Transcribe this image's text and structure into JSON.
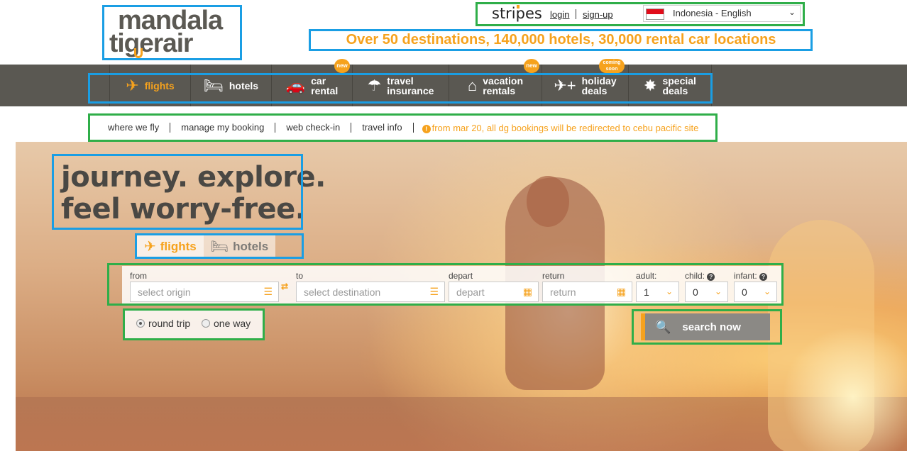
{
  "logo": {
    "line1": "mandala",
    "line2": "tigerair"
  },
  "topbar": {
    "brand": "stripes",
    "login": "login",
    "signup": "sign-up",
    "language": "Indonesia - English"
  },
  "tagline": "Over 50 destinations, 140,000 hotels, 30,000 rental car locations",
  "nav": {
    "items": [
      {
        "label": "flights",
        "icon": "plane-icon",
        "glyph": "✈",
        "badge": ""
      },
      {
        "label": "hotels",
        "icon": "bed-icon",
        "glyph": "🛏",
        "badge": ""
      },
      {
        "label": "car\nrental",
        "icon": "car-icon",
        "glyph": "🚗",
        "badge": "new"
      },
      {
        "label": "travel\ninsurance",
        "icon": "umbrella-icon",
        "glyph": "☂",
        "badge": ""
      },
      {
        "label": "vacation\nrentals",
        "icon": "house-icon",
        "glyph": "⌂",
        "badge": "new"
      },
      {
        "label": "holiday\ndeals",
        "icon": "plane-plus-building-icon",
        "glyph": "✈+",
        "badge": "coming\nsoon"
      },
      {
        "label": "special\ndeals",
        "icon": "dollar-star-icon",
        "glyph": "✸",
        "badge": ""
      }
    ]
  },
  "subnav": {
    "links": [
      "where we fly",
      "manage my booking",
      "web check-in",
      "travel info"
    ],
    "notice": "from mar 20, all dg bookings will be redirected to cebu pacific site"
  },
  "hero": {
    "headline1": "journey. explore.",
    "headline2": "feel worry-free."
  },
  "tabs": {
    "flights": "flights",
    "hotels": "hotels"
  },
  "form": {
    "from_label": "from",
    "from_placeholder": "select origin",
    "to_label": "to",
    "to_placeholder": "select destination",
    "depart_label": "depart",
    "depart_placeholder": "depart",
    "return_label": "return",
    "return_placeholder": "return",
    "adult_label": "adult:",
    "adult_value": "1",
    "child_label": "child:",
    "child_value": "0",
    "infant_label": "infant:",
    "infant_value": "0"
  },
  "trip": {
    "round": "round trip",
    "oneway": "one way",
    "selected": "round trip"
  },
  "search_button": "search now",
  "colors": {
    "accent": "#f6a21d",
    "nav_bg": "#5a5852",
    "annotation_blue": "#1a9ee4",
    "annotation_green": "#2fae49"
  }
}
